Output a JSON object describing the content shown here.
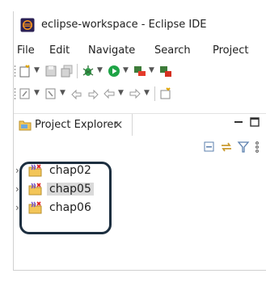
{
  "window": {
    "title": "eclipse-workspace - Eclipse IDE"
  },
  "menu": {
    "items": [
      "File",
      "Edit",
      "Navigate",
      "Search",
      "Project"
    ]
  },
  "view": {
    "tab_label": "Project Explorer",
    "close_glyph": "×"
  },
  "projects": [
    {
      "name": "chap02",
      "selected": false
    },
    {
      "name": "chap05",
      "selected": true
    },
    {
      "name": "chap06",
      "selected": false
    }
  ],
  "colors": {
    "selection": "#dadada",
    "annotation_border": "#1d2f40",
    "run_green": "#1ea446"
  },
  "icons": {
    "app": "eclipse-logo-icon",
    "view": "project-explorer-icon",
    "project": "java-project-icon",
    "tree_toggle": "chevron-right-icon"
  }
}
